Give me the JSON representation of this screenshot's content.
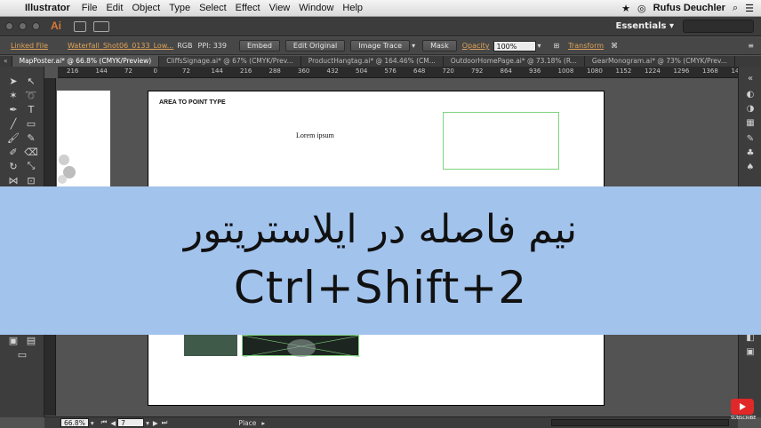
{
  "menubar": {
    "app": "Illustrator",
    "items": [
      "File",
      "Edit",
      "Object",
      "Type",
      "Select",
      "Effect",
      "View",
      "Window",
      "Help"
    ],
    "user": "Rufus Deuchler"
  },
  "appbar": {
    "logo": "Ai",
    "workspace": "Essentials ▾"
  },
  "control": {
    "linked": "Linked File",
    "filename": "Waterfall_Shot06_0133_Low...",
    "color_mode": "RGB",
    "ppi_label": "PPI: 339",
    "embed": "Embed",
    "edit_original": "Edit Original",
    "image_trace": "Image Trace",
    "mask": "Mask",
    "opacity_label": "Opacity",
    "opacity_value": "100%",
    "transform": "Transform"
  },
  "tabs": [
    "MapPoster.ai* @ 66.8% (CMYK/Preview)",
    "CliffsSignage.ai* @ 67% (CMYK/Prev...",
    "ProductHangtag.ai* @ 164.46% (CM...",
    "OutdoorHomePage.ai* @ 73.18% (R...",
    "GearMonogram.ai* @ 73% (CMYK/Prev..."
  ],
  "ruler_ticks": [
    "216",
    "144",
    "72",
    "0",
    "72",
    "144",
    "216",
    "288",
    "360",
    "432",
    "504",
    "576",
    "648",
    "720",
    "792",
    "864",
    "936",
    "1008",
    "1080",
    "1152",
    "1224",
    "1296",
    "1368",
    "14"
  ],
  "artboard": {
    "heading": "AREA TO POINT TYPE",
    "sample": "Lorem ipsum"
  },
  "banner": {
    "persian": "نیم فاصله در ایلاستریتور",
    "shortcut": "Ctrl+Shift+2"
  },
  "status": {
    "zoom": "66.8%",
    "artboard_num": "7",
    "tool": "Place"
  },
  "youtube": {
    "label": "SUBSCRIBE"
  },
  "colors": {
    "banner": "#a2c3ec",
    "selection": "#7ed27e",
    "accent": "#e0a358"
  }
}
